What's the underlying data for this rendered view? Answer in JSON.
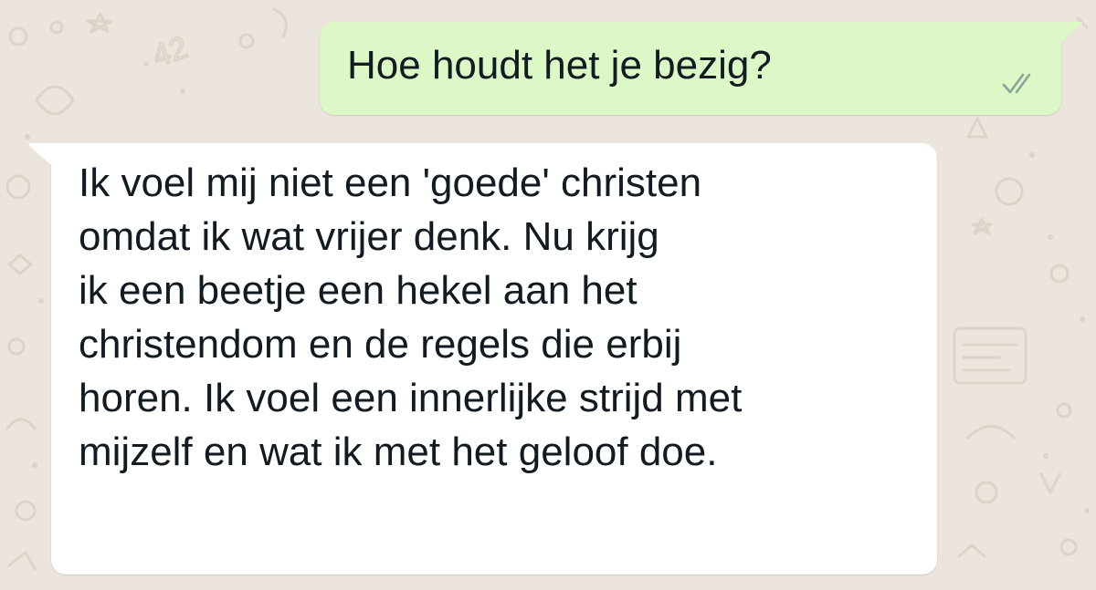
{
  "conversation": {
    "outgoing": {
      "text": "Hoe houdt het je bezig?",
      "status_icon": "double-check-icon",
      "bubble_color": "#dcf8c6",
      "tick_color": "#8aa39b"
    },
    "incoming": {
      "text": "Ik voel mij niet een 'goede' christen\nomdat ik wat vrijer denk. Nu krijg\nik een beetje een hekel aan het\nchristendom en de regels die erbij\nhoren. Ik voel een innerlijke strijd met\nmijzelf en wat ik met het geloof doe.",
      "bubble_color": "#ffffff"
    }
  },
  "wallpaper": {
    "background_color": "#ece5dd",
    "doodle_color": "#d9d0c4",
    "doodle_number": "42"
  }
}
